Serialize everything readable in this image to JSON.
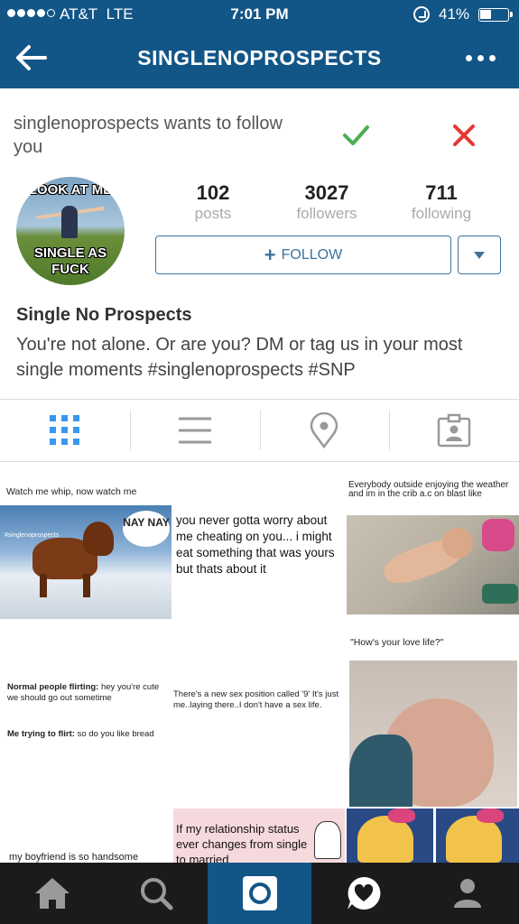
{
  "status_bar": {
    "carrier": "AT&T",
    "network": "LTE",
    "time": "7:01 PM",
    "battery": "41%"
  },
  "nav": {
    "title": "SINGLENOPROSPECTS",
    "back_icon": "back-arrow-icon",
    "more_icon": "more-dots-icon"
  },
  "request": {
    "text": "singlenoprospects wants to follow you",
    "accept_icon": "checkmark-icon",
    "decline_icon": "close-icon",
    "accept_color": "#4caf50",
    "decline_color": "#e53935"
  },
  "profile": {
    "avatar_top": "LOOK AT ME",
    "avatar_bottom": "SINGLE AS FUCK",
    "stats": [
      {
        "value": "102",
        "label": "posts"
      },
      {
        "value": "3027",
        "label": "followers"
      },
      {
        "value": "711",
        "label": "following"
      }
    ],
    "follow_label": "FOLLOW",
    "full_name": "Single No Prospects",
    "bio": "You're not alone. Or are you? DM or tag us in your most single moments #singlenoprospects #SNP"
  },
  "view_tabs": [
    "grid-icon",
    "list-icon",
    "location-pin-icon",
    "tagged-photos-icon"
  ],
  "posts": [
    {
      "caption": "Watch me whip, now watch me",
      "overlay": "NAY NAY",
      "small": "#singlenoprospects"
    },
    {
      "text": "you never gotta worry about me cheating on you... i might eat something that was yours but thats about it"
    },
    {
      "caption": "Everybody outside enjoying the weather and im in the crib a.c on blast like"
    },
    {
      "line1_bold": "Normal people flirting:",
      "line1": " hey you're cute we should go out sometime",
      "line2_bold": "Me trying to flirt:",
      "line2": " so do you like bread"
    },
    {
      "text": "There's a new sex position called '9' It's just me..laying there..I don't have a sex life."
    },
    {
      "caption": "\"How's your love life?\""
    },
    {
      "caption": "my boyfriend is so handsome"
    },
    {
      "text": "If my relationship status ever changes from single to married"
    }
  ],
  "bottom_tabs": [
    "home-icon",
    "search-icon",
    "camera-icon",
    "activity-heart-icon",
    "profile-icon"
  ],
  "colors": {
    "brand": "#125688",
    "button": "#3f729b",
    "bottom_bar": "#1b1b1b"
  }
}
